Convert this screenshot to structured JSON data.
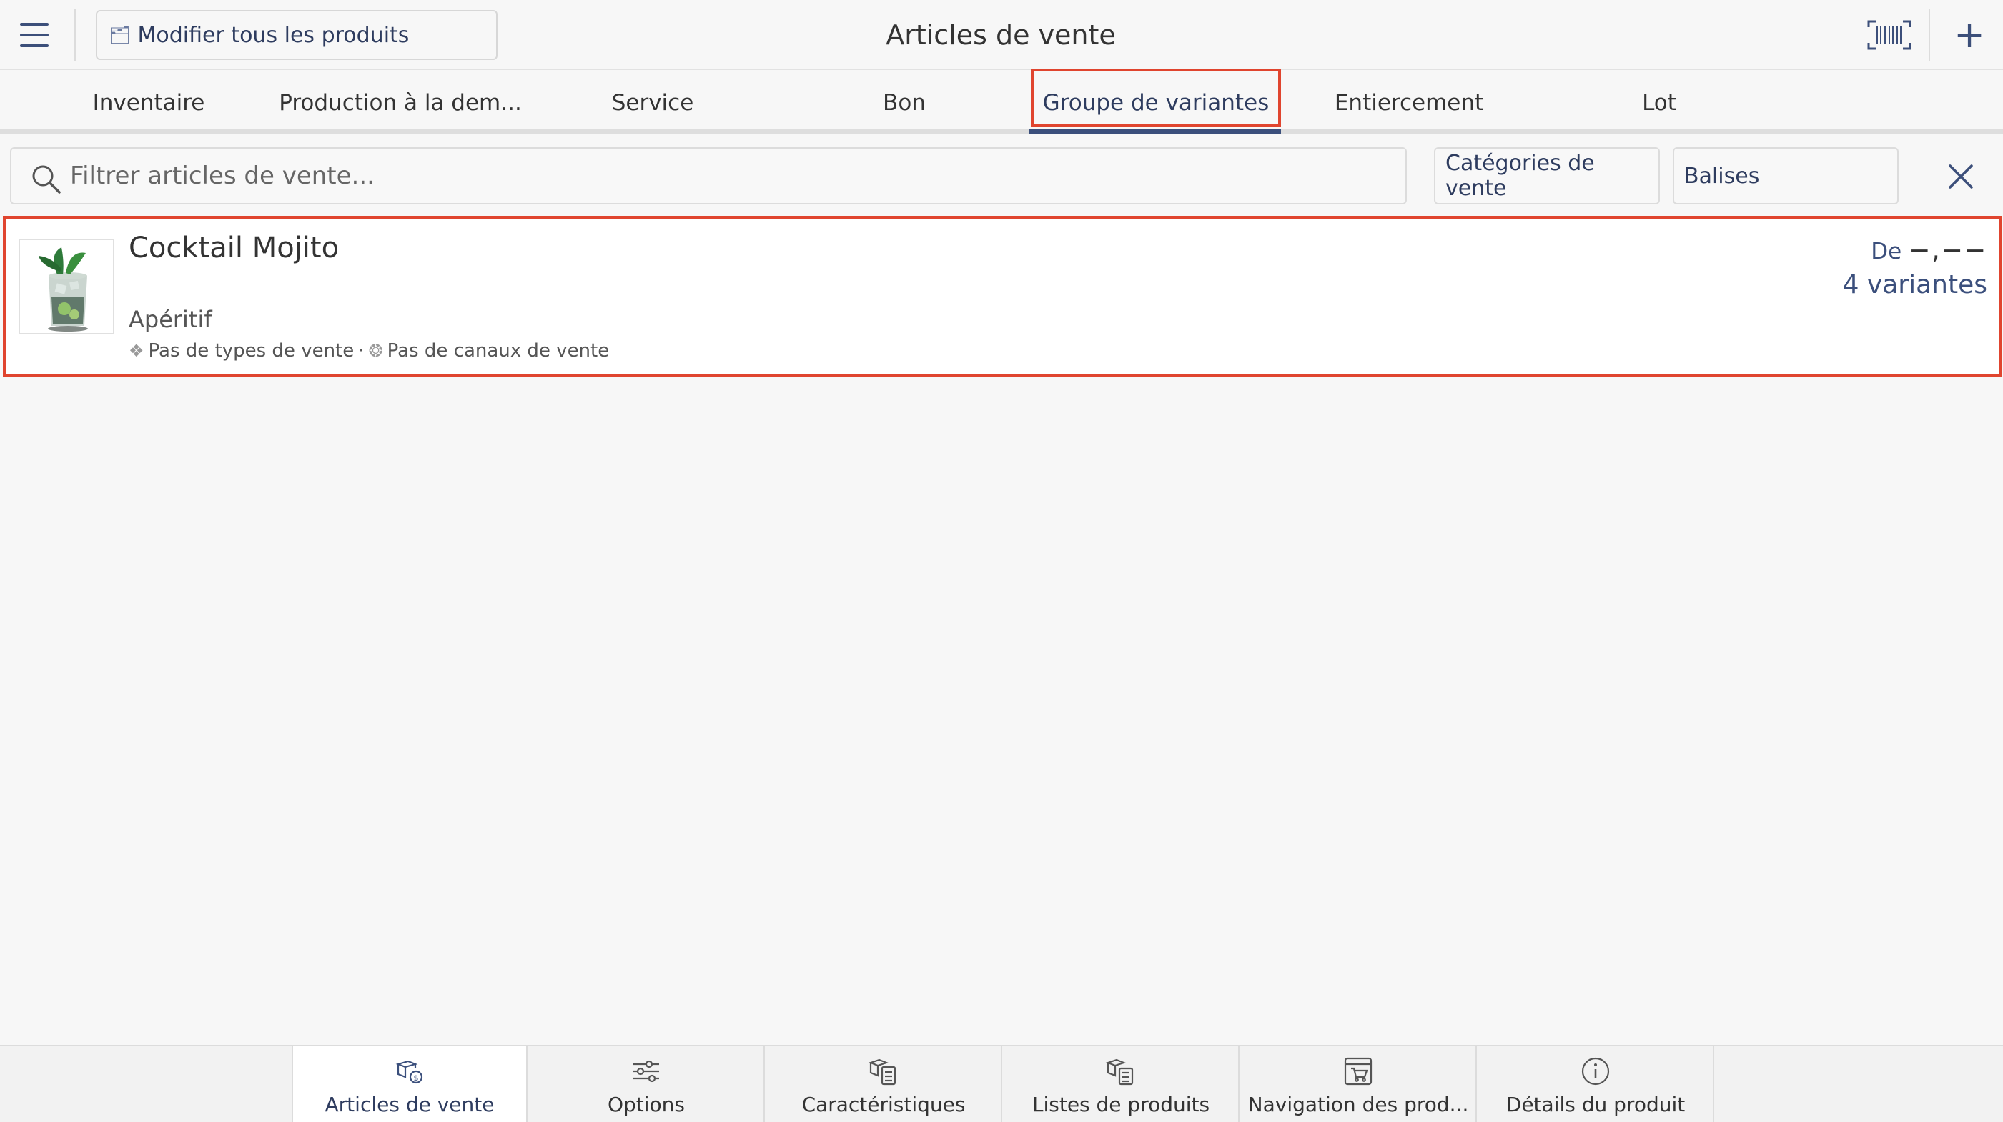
{
  "header": {
    "edit_all_label": "Modifier tous les produits",
    "title": "Articles de vente",
    "add_label": "+"
  },
  "tabs": [
    {
      "label": "Inventaire"
    },
    {
      "label": "Production à la dem..."
    },
    {
      "label": "Service"
    },
    {
      "label": "Bon"
    },
    {
      "label": "Groupe de variantes",
      "selected": true
    },
    {
      "label": "Entiercement"
    },
    {
      "label": "Lot"
    }
  ],
  "filters": {
    "search_placeholder": "Filtrer articles de vente...",
    "search_value": "",
    "categories_label": "Catégories de vente",
    "tags_label": "Balises"
  },
  "item": {
    "name": "Cocktail Mojito",
    "category": "Apéritif",
    "sales_types": "Pas de types de vente",
    "meta_separator": "·",
    "sales_channels": "Pas de canaux de vente",
    "price_prefix": "De",
    "price_value": "−,−−",
    "variants": "4 variantes"
  },
  "bottom_nav": [
    {
      "label": "Articles de vente",
      "icon": "sales-items-icon",
      "active": true
    },
    {
      "label": "Options",
      "icon": "sliders-icon"
    },
    {
      "label": "Caractéristiques",
      "icon": "characteristics-icon"
    },
    {
      "label": "Listes de produits",
      "icon": "product-lists-icon"
    },
    {
      "label": "Navigation des prod...",
      "icon": "product-navigation-icon"
    },
    {
      "label": "Détails du produit",
      "icon": "info-icon"
    }
  ],
  "colors": {
    "accent": "#3b4f7c",
    "highlight": "#e0452f",
    "background": "#f7f7f7"
  }
}
